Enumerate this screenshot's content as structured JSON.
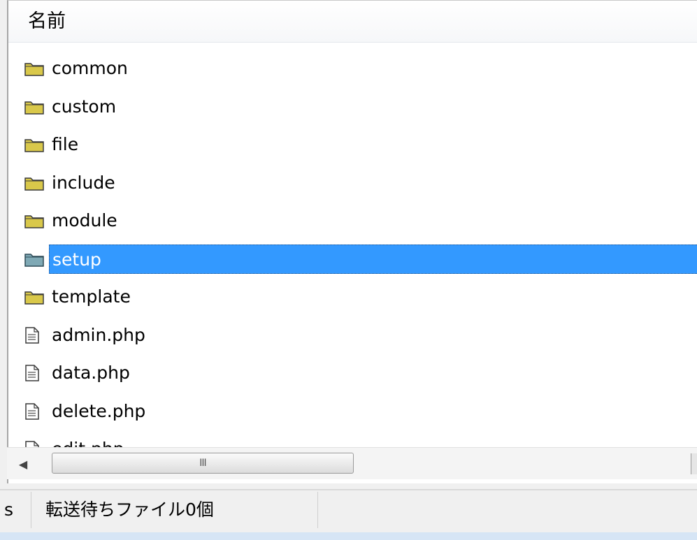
{
  "list": {
    "column_header": "名前",
    "items": [
      {
        "name": "common",
        "type": "folder",
        "selected": false
      },
      {
        "name": "custom",
        "type": "folder",
        "selected": false
      },
      {
        "name": "file",
        "type": "folder",
        "selected": false
      },
      {
        "name": "include",
        "type": "folder",
        "selected": false
      },
      {
        "name": "module",
        "type": "folder",
        "selected": false
      },
      {
        "name": "setup",
        "type": "folder",
        "selected": true
      },
      {
        "name": "template",
        "type": "folder",
        "selected": false
      },
      {
        "name": "admin.php",
        "type": "file",
        "selected": false
      },
      {
        "name": "data.php",
        "type": "file",
        "selected": false
      },
      {
        "name": "delete.php",
        "type": "file",
        "selected": false
      },
      {
        "name": "edit.php",
        "type": "file",
        "selected": false
      }
    ]
  },
  "scrollbar": {
    "left_arrow_icon": "left-arrow-icon",
    "thumb_grip": "III"
  },
  "status": {
    "left_fragment": "s",
    "queue_text": "転送待ちファイル0個"
  },
  "colors": {
    "selection": "#3399ff",
    "folder": "#d9c84a",
    "selected_folder": "#7fa9b5"
  }
}
